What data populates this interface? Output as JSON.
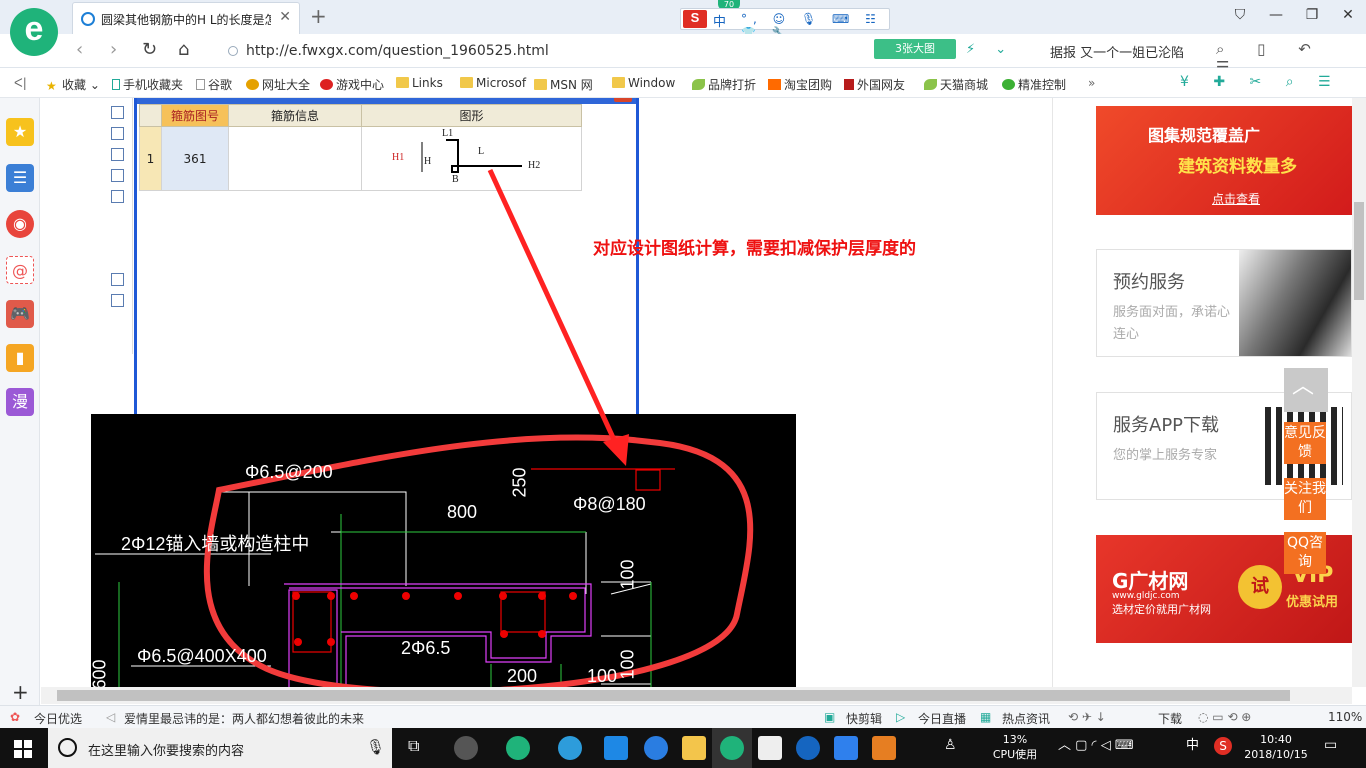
{
  "browser": {
    "tab_title": "圆梁其他钢筋中的H L的长度是怎",
    "tab_close": "✕",
    "new_tab": "+",
    "ime_label": "中",
    "ime_s": "S",
    "ime_badge": "70",
    "url": "http://e.fwxgx.com/question_1960525.html",
    "big_image_button": "3张大图",
    "news_ticker": "据报 又一个一姐已沦陷",
    "window_controls": [
      "⛉",
      "—",
      "❐",
      "✕"
    ]
  },
  "bookmarks": [
    {
      "label": "收藏",
      "icon": "star-icon"
    },
    {
      "label": "手机收藏夹",
      "icon": "phone-icon"
    },
    {
      "label": "谷歌",
      "icon": "page-icon"
    },
    {
      "label": "网址大全",
      "icon": "globe-icon"
    },
    {
      "label": "游戏中心",
      "icon": "game-icon"
    },
    {
      "label": "Links",
      "icon": "folder-icon"
    },
    {
      "label": "Microsof",
      "icon": "folder-icon"
    },
    {
      "label": "MSN 网",
      "icon": "folder-icon"
    },
    {
      "label": "Window",
      "icon": "folder-icon"
    },
    {
      "label": "品牌打折",
      "icon": "leaf-icon"
    },
    {
      "label": "淘宝团购",
      "icon": "taobao-icon"
    },
    {
      "label": "外国网友",
      "icon": "flag-icon"
    },
    {
      "label": "天猫商城",
      "icon": "leaf-icon"
    },
    {
      "label": "精准控制",
      "icon": "wechat-icon"
    }
  ],
  "dialog": {
    "columns": [
      "箍筋图号",
      "箍筋信息",
      "图形"
    ],
    "row": {
      "num": "1",
      "code": "361",
      "info": ""
    },
    "shape_labels": {
      "L1": "L1",
      "L": "L",
      "H1": "H1",
      "H": "H",
      "B": "B",
      "H2": "H2"
    }
  },
  "annotation": "对应设计图纸计算，需要扣减保护层厚度的",
  "cad": {
    "labels": [
      "Φ6.5@200",
      "250",
      "800",
      "Φ8@180",
      "2Φ12锚入墙或构造柱中",
      "100",
      "2Φ6.5",
      "Φ6.5@400X400",
      "100",
      "200",
      "100",
      "600"
    ]
  },
  "ads": {
    "ad1": {
      "line1": "图集规范覆盖广",
      "line2": "建筑资料数量多",
      "link": "点击查看"
    },
    "service": {
      "title": "预约服务",
      "desc": "服务面对面，承诺心连心"
    },
    "app": {
      "title": "服务APP下载",
      "desc": "您的掌上服务专家"
    },
    "ad2": {
      "brand": "G广材网",
      "site": "www.gldjc.com",
      "slogan": "选材定价就用广材网",
      "try": "试",
      "vip": "VIP",
      "vip_sub": "优惠试用"
    }
  },
  "float_buttons": [
    "意见反馈",
    "关注我们",
    "QQ咨询"
  ],
  "status_bar": {
    "left1": "今日优选",
    "left2": "爱情里最忌讳的是：两人都幻想着彼此的未来",
    "quick_cut": "快剪辑",
    "live": "今日直播",
    "hot": "热点资讯",
    "download": "下载",
    "zoom": "110%"
  },
  "taskbar": {
    "search_placeholder": "在这里输入你要搜索的内容",
    "cpu_percent": "13%",
    "cpu_label": "CPU使用",
    "ime": "中",
    "time": "10:40",
    "date": "2018/10/15"
  }
}
